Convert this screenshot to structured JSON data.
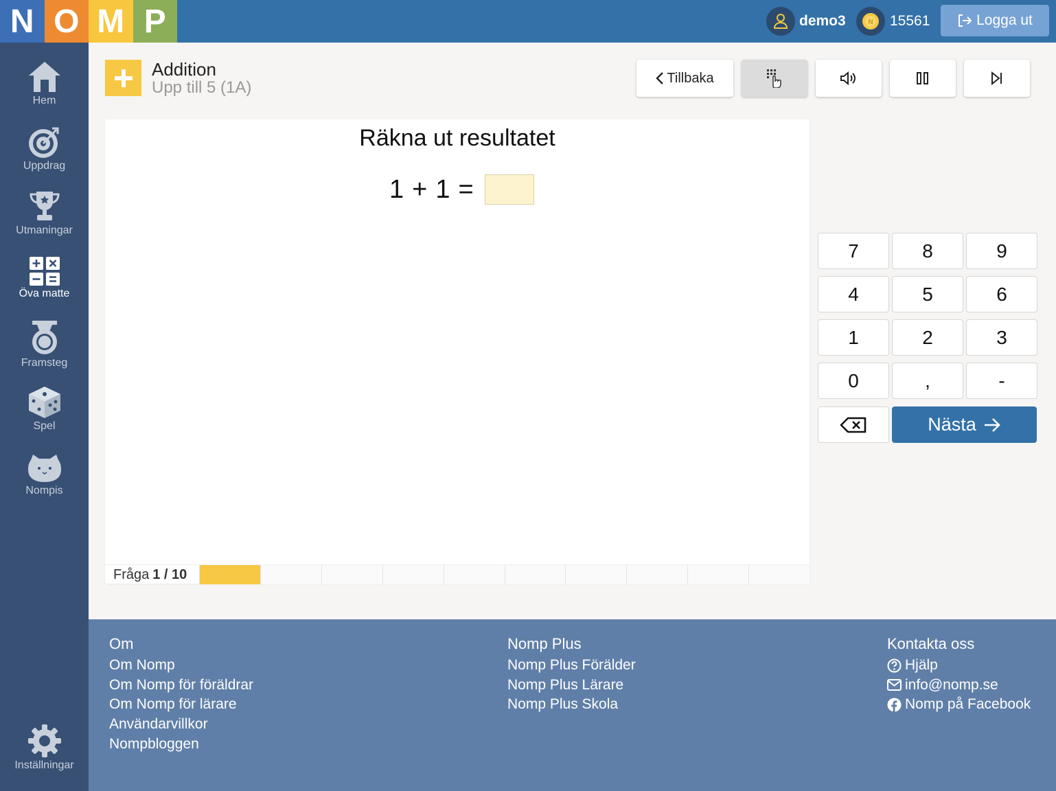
{
  "header": {
    "logo_letters": [
      "N",
      "O",
      "M",
      "P"
    ],
    "logo_colors": [
      "#3c6fb6",
      "#ee8a32",
      "#f8c73d",
      "#8cae58"
    ],
    "username": "demo3",
    "coins": "15561",
    "logout_label": "Logga ut"
  },
  "sidebar": {
    "items": [
      {
        "label": "Hem",
        "icon": "home-icon"
      },
      {
        "label": "Uppdrag",
        "icon": "target-icon"
      },
      {
        "label": "Utmaningar",
        "icon": "trophy-icon"
      },
      {
        "label": "Öva matte",
        "icon": "calculator-icon",
        "active": true
      },
      {
        "label": "Framsteg",
        "icon": "medal-icon"
      },
      {
        "label": "Spel",
        "icon": "dice-icon"
      },
      {
        "label": "Nompis",
        "icon": "pet-icon"
      }
    ],
    "settings_label": "Inställningar"
  },
  "exercise": {
    "title": "Addition",
    "subtitle": "Upp till 5 (1A)",
    "back_label": "Tillbaka",
    "instruction": "Räkna ut resultatet",
    "operand1": "1",
    "operator": "+",
    "operand2": "1",
    "equals": "=",
    "answer": "",
    "progress_label": "Fråga",
    "progress_count": "1 / 10",
    "progress_current": 1,
    "progress_total": 10
  },
  "keypad": {
    "keys": [
      "7",
      "8",
      "9",
      "4",
      "5",
      "6",
      "1",
      "2",
      "3",
      "0",
      ",",
      "-"
    ],
    "next_label": "Nästa"
  },
  "footer": {
    "col1": {
      "heading": "Om",
      "links": [
        "Om Nomp",
        "Om Nomp för föräldrar",
        "Om Nomp för lärare",
        "Användarvillkor",
        "Nompbloggen"
      ]
    },
    "col2": {
      "heading": "Nomp Plus",
      "links": [
        "Nomp Plus Förälder",
        "Nomp Plus Lärare",
        "Nomp Plus Skola"
      ]
    },
    "col3": {
      "heading": "Kontakta oss",
      "links": [
        "Hjälp",
        "info@nomp.se",
        "Nomp på Facebook"
      ]
    }
  },
  "colors": {
    "brand_blue": "#3371a8",
    "sidebar": "#375074",
    "footer": "#607fa8",
    "accent_yellow": "#f6c843"
  }
}
